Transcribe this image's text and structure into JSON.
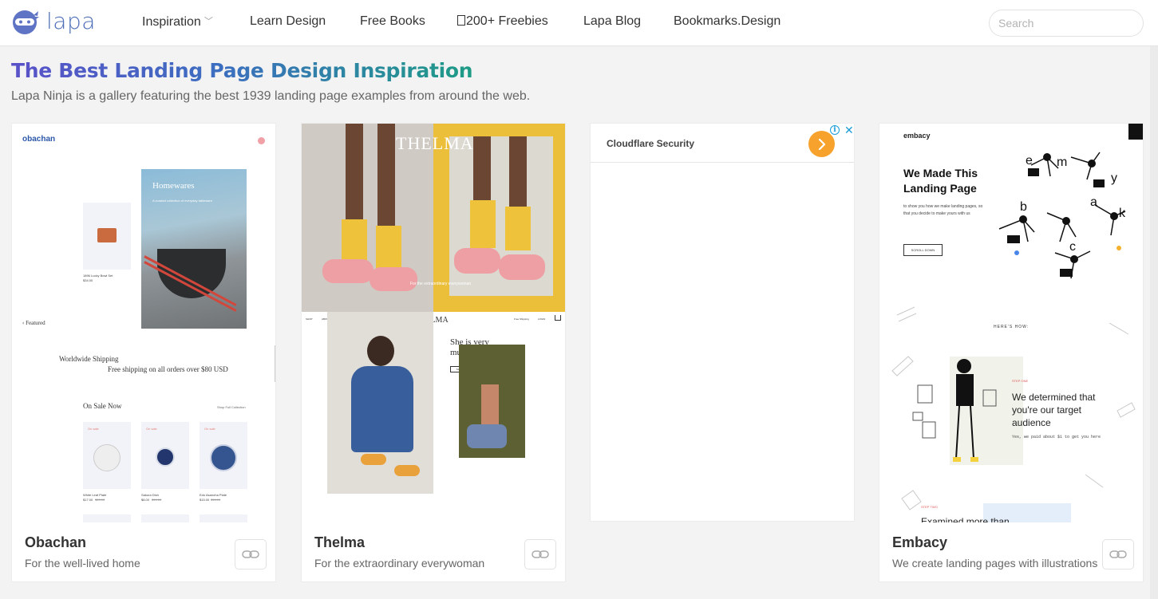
{
  "brand": {
    "name": "lapa"
  },
  "nav": {
    "items": [
      {
        "label": "Inspiration",
        "has_caret": true
      },
      {
        "label": "Learn Design"
      },
      {
        "label": "Free Books"
      },
      {
        "label": "200+ Freebies",
        "icon": "gift-icon"
      },
      {
        "label": "Lapa Blog"
      },
      {
        "label": "Bookmarks.Design"
      }
    ],
    "search_placeholder": "Search"
  },
  "header": {
    "title": "The Best Landing Page Design Inspiration",
    "subtitle": "Lapa Ninja is a gallery featuring the best 1939 landing page examples from around the web."
  },
  "colors": {
    "accent": "#4f6fb8",
    "gradient_start": "#5a52c9",
    "gradient_end": "#1e9c86",
    "ad_button": "#f6a22c"
  },
  "cards": [
    {
      "name": "Obachan",
      "description": "For the well-lived home",
      "thumb": {
        "logo": "obachan",
        "hero_title": "Homewares",
        "hero_text": "A curated collection of everyday tableware",
        "product_name": "1896 Lucky Bowl Set",
        "product_price": "$34.00",
        "featured": "‹ Featured",
        "shipping_title": "Worldwide Shipping",
        "shipping_text": "Free shipping on all orders over $80 USD",
        "sale_title": "On Sale Now",
        "shop_all": "Shop Full Collection",
        "sale_badge": "On sale",
        "items": [
          {
            "name": "White Leaf Plate",
            "price": "$17.00",
            "old": "$20.00"
          },
          {
            "name": "Sakura Dish",
            "price": "$8.00",
            "old": "$10.00"
          },
          {
            "name": "Edo Asanoha Plate",
            "price": "$15.00",
            "old": "$18.00"
          }
        ]
      }
    },
    {
      "name": "Thelma",
      "description": "For the extraordinary everywoman",
      "thumb": {
        "brand": "THELMA",
        "brand_small": "THELMA",
        "nav": [
          "SHOP",
          "ABOUT",
          "STORE"
        ],
        "nav_right": [
          "Free Shipping",
          "LOGIN"
        ],
        "headline_line1": "She is very",
        "headline_line2": "much herself.",
        "cta": "SHOP NOW",
        "caption": "For the extraordinary everywoman"
      }
    },
    {
      "name": "Embacy",
      "description": "We create landing pages with illustrations",
      "thumb": {
        "logo": "embacy",
        "hero_line1": "We Made This",
        "hero_line2": "Landing Page",
        "hero_text": "to show you how we make landing pages, so that you decide to make yours with us",
        "scroll": "SCROLL DOWN",
        "heres_how": "HERE'S HOW:",
        "step_label": "STEP ONE",
        "step_line1": "We determined that",
        "step_line2": "you're our target",
        "step_line3": "audience",
        "step_text": "Yes, we paid about $1 to get you here",
        "step2_label": "STEP TWO",
        "step2_title": "Examined more than",
        "letters": [
          "e",
          "m",
          "b",
          "a",
          "c",
          "y",
          "k"
        ]
      }
    }
  ],
  "ad": {
    "title": "Cloudflare Security",
    "info": "i",
    "close": "✕"
  }
}
